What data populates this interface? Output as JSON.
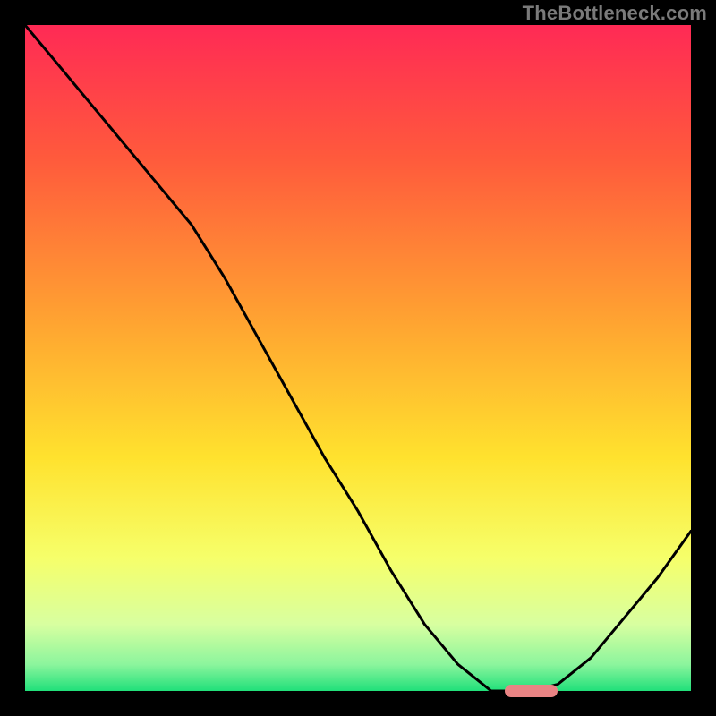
{
  "watermark": "TheBottleneck.com",
  "chart_data": {
    "type": "line",
    "title": "",
    "xlabel": "",
    "ylabel": "",
    "xlim": [
      0,
      1
    ],
    "ylim": [
      0,
      1
    ],
    "grid": false,
    "series": [
      {
        "name": "bottleneck-curve",
        "x": [
          0.0,
          0.05,
          0.1,
          0.15,
          0.2,
          0.25,
          0.3,
          0.35,
          0.4,
          0.45,
          0.5,
          0.55,
          0.6,
          0.65,
          0.7,
          0.72,
          0.76,
          0.8,
          0.85,
          0.9,
          0.95,
          1.0
        ],
        "y": [
          1.0,
          0.94,
          0.88,
          0.82,
          0.76,
          0.7,
          0.62,
          0.53,
          0.44,
          0.35,
          0.27,
          0.18,
          0.1,
          0.04,
          0.0,
          0.0,
          0.0,
          0.01,
          0.05,
          0.11,
          0.17,
          0.24
        ]
      }
    ],
    "marker": {
      "x_start": 0.72,
      "x_end": 0.8,
      "y": 0.0,
      "color": "#e98484"
    },
    "gradient_stops": [
      {
        "pos": 0.0,
        "color": "#ff2a55"
      },
      {
        "pos": 0.2,
        "color": "#ff5a3c"
      },
      {
        "pos": 0.45,
        "color": "#ffa531"
      },
      {
        "pos": 0.65,
        "color": "#ffe22e"
      },
      {
        "pos": 0.8,
        "color": "#f6ff6a"
      },
      {
        "pos": 0.9,
        "color": "#d8ffa0"
      },
      {
        "pos": 0.96,
        "color": "#8cf59d"
      },
      {
        "pos": 1.0,
        "color": "#20e07a"
      }
    ]
  }
}
